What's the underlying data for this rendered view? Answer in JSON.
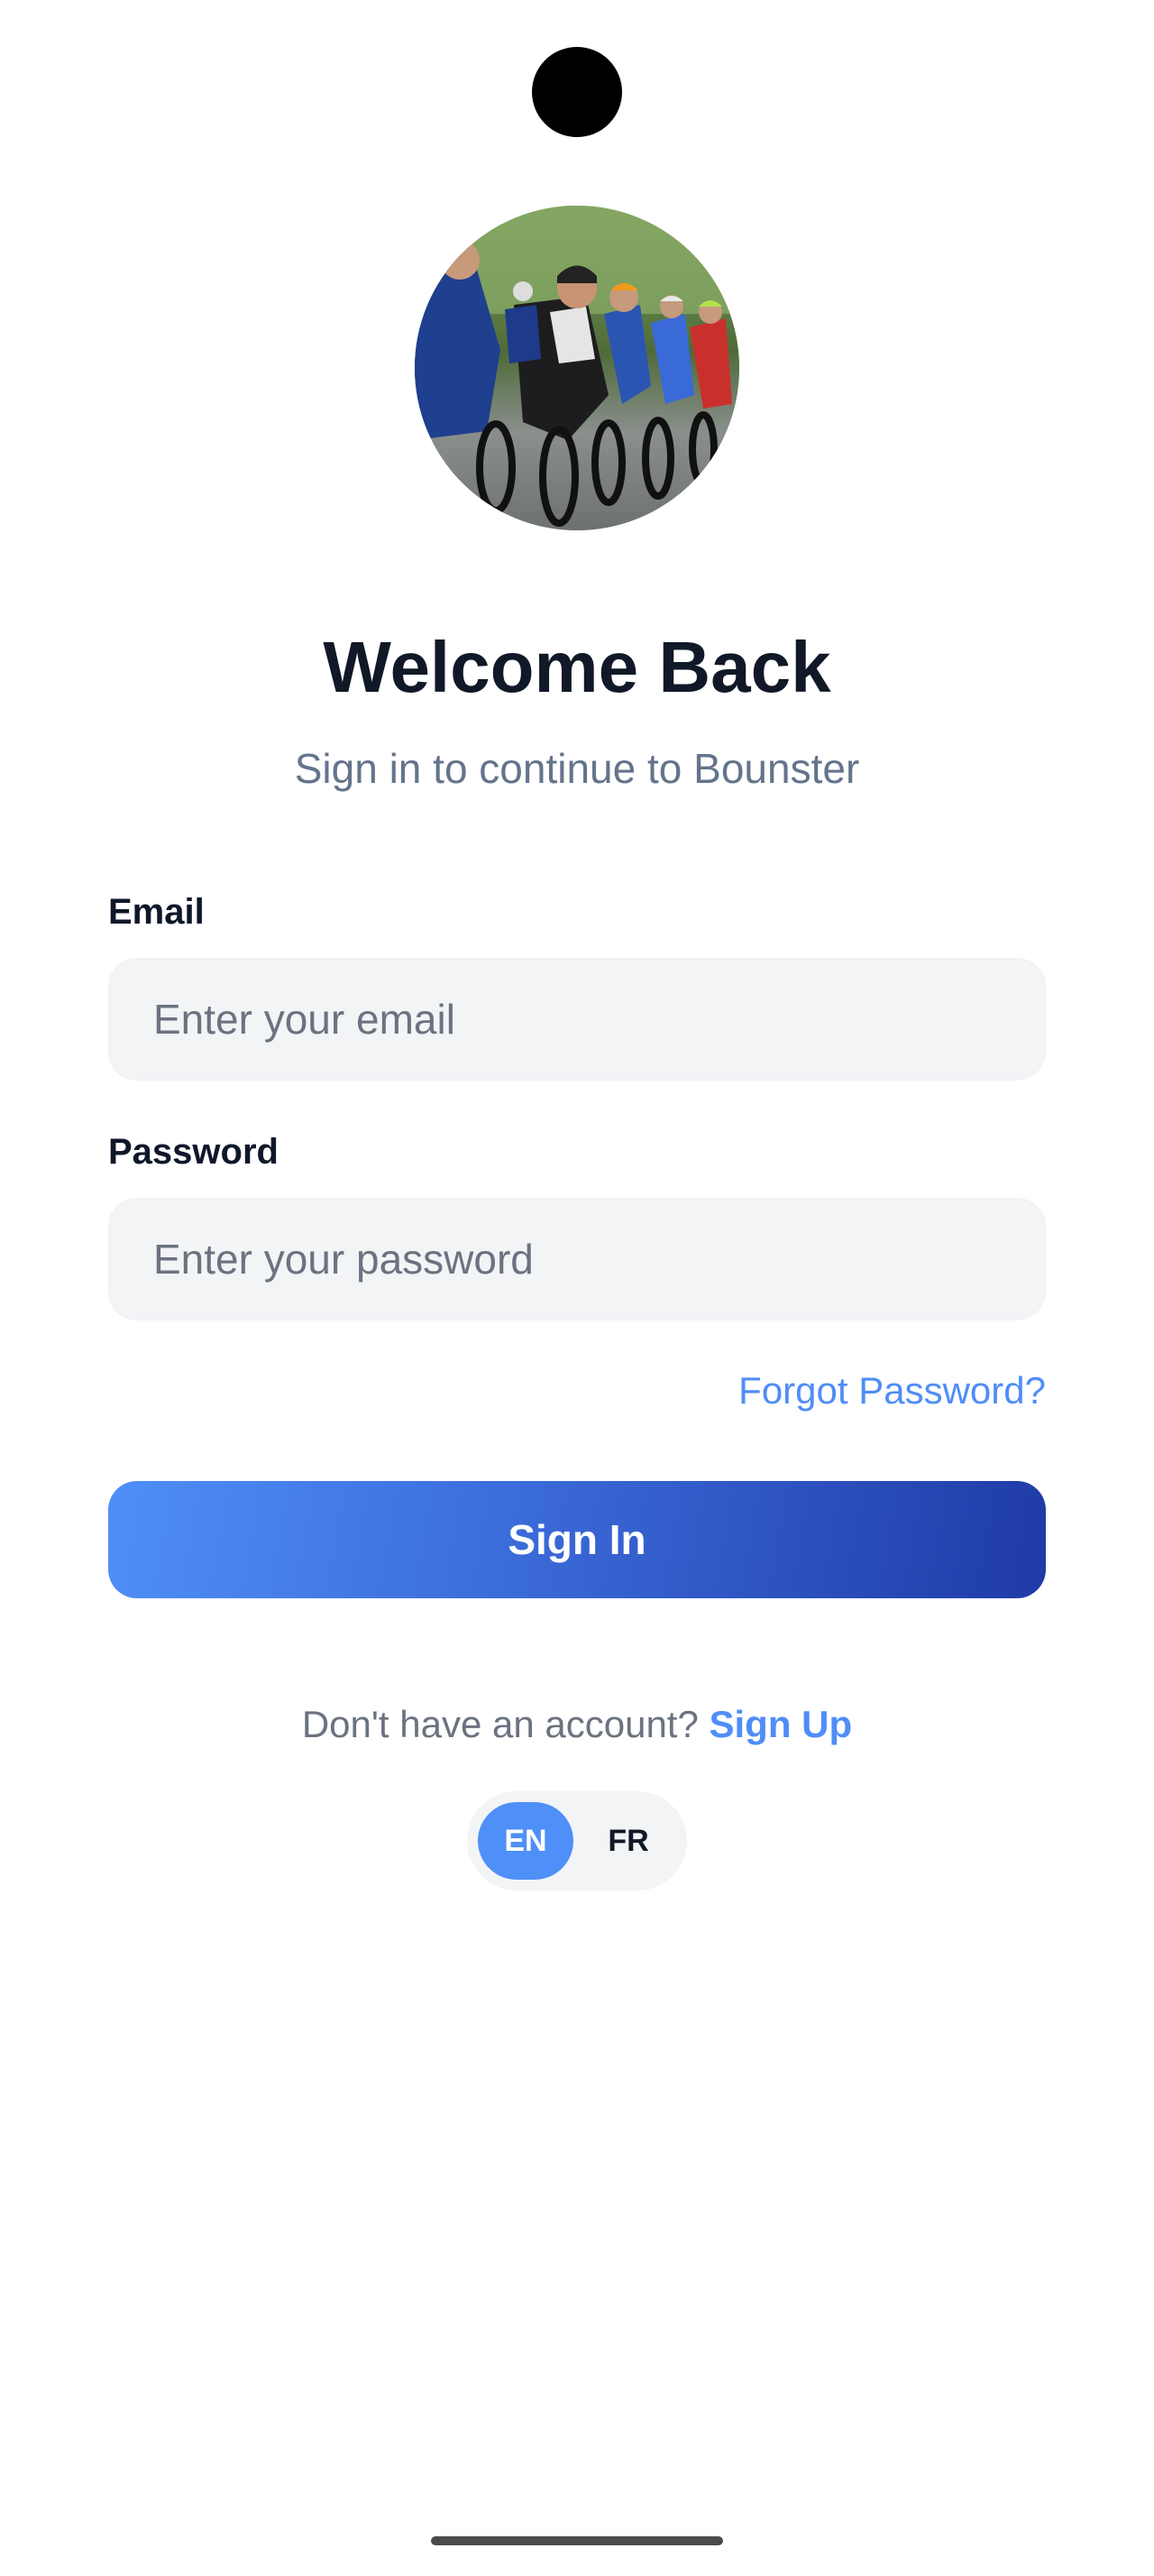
{
  "header": {
    "title": "Welcome Back",
    "subtitle": "Sign in to continue to Bounster"
  },
  "avatar": {
    "icon": "cyclists-photo"
  },
  "form": {
    "email_label": "Email",
    "email_placeholder": "Enter your email",
    "email_value": "",
    "password_label": "Password",
    "password_placeholder": "Enter your password",
    "password_value": "",
    "forgot_label": "Forgot Password?",
    "submit_label": "Sign In"
  },
  "signup": {
    "prompt": "Don't have an account?",
    "link_label": "Sign Up"
  },
  "language": {
    "options": [
      "EN",
      "FR"
    ],
    "selected": "EN"
  },
  "colors": {
    "accent": "#4F8DF7",
    "gradient_start": "#4F8FF8",
    "gradient_end": "#1F3AA6",
    "title": "#111827",
    "muted": "#64748B",
    "field_bg": "#F3F4F6"
  }
}
